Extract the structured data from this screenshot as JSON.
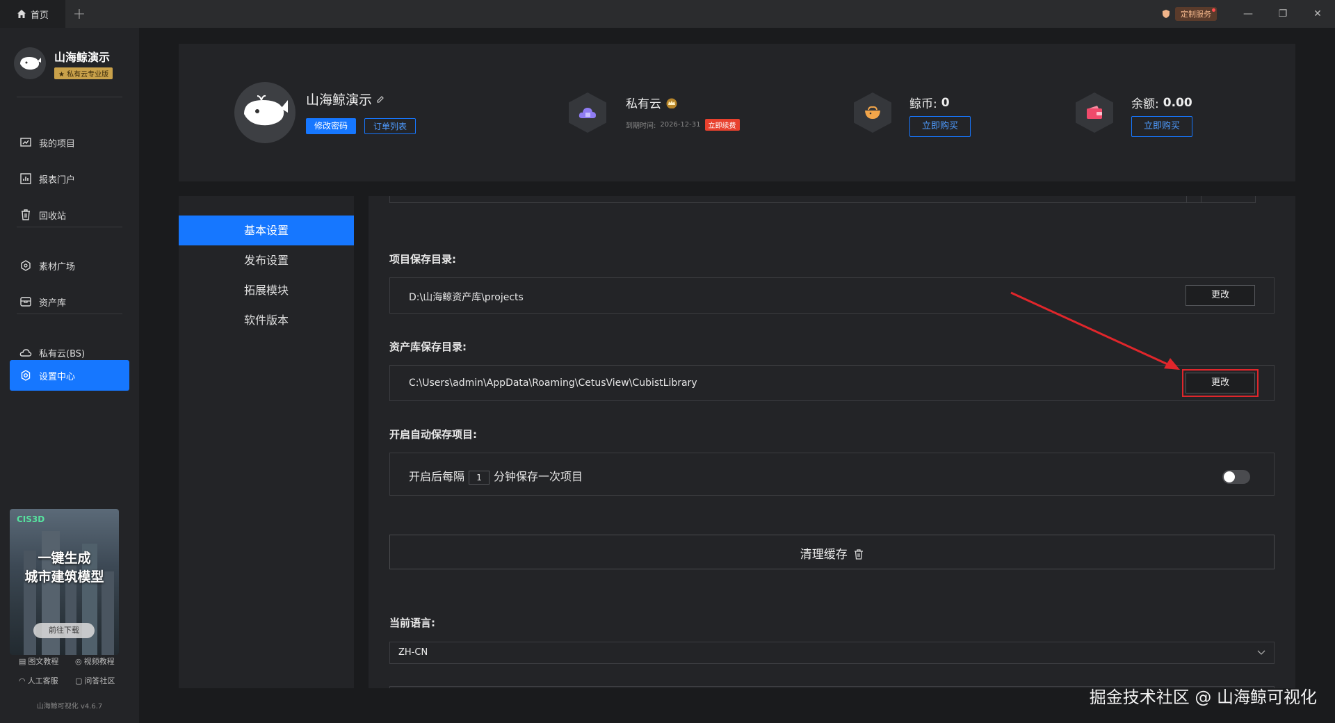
{
  "titlebar": {
    "home_tab": "首页",
    "add_tab": "+",
    "custom_service": "定制服务",
    "minimize": "—",
    "restore": "❐",
    "close": "✕"
  },
  "sidebar": {
    "brand_name": "山海鲸演示",
    "brand_badge": "★ 私有云专业版",
    "items": [
      {
        "label": "我的项目"
      },
      {
        "label": "报表门户"
      },
      {
        "label": "回收站"
      },
      {
        "label": "素材广场"
      },
      {
        "label": "资产库"
      },
      {
        "label": "私有云(BS)"
      },
      {
        "label": "设置中心"
      }
    ],
    "promo": {
      "logo": "CIS3D",
      "title_line1": "一键生成",
      "title_line2": "城市建筑模型",
      "button": "前往下载"
    },
    "help": {
      "doc_tutorial": "图文教程",
      "video_tutorial": "视频教程",
      "support": "人工客服",
      "community": "问答社区"
    },
    "version": "山海鲸可视化 v4.6.7"
  },
  "header": {
    "user_name": "山海鲸演示",
    "change_password": "修改密码",
    "order_list": "订单列表",
    "private_cloud": {
      "title": "私有云",
      "expire_label": "到期时间:",
      "expire_date": "2026-12-31",
      "renew": "立即续费"
    },
    "coins": {
      "label": "鲸币:",
      "value": "0",
      "buy": "立即购买"
    },
    "balance": {
      "label": "余额:",
      "value": "0.00",
      "buy": "立即购买"
    }
  },
  "settings_menu": {
    "items": [
      {
        "label": "基本设置"
      },
      {
        "label": "发布设置"
      },
      {
        "label": "拓展模块"
      },
      {
        "label": "软件版本"
      }
    ]
  },
  "settings": {
    "project_dir_label": "项目保存目录:",
    "project_dir_value": "D:\\山海鲸资产库\\projects",
    "asset_dir_label": "资产库保存目录:",
    "asset_dir_value": "C:\\Users\\admin\\AppData\\Roaming\\CetusView\\CubistLibrary",
    "change_label": "更改",
    "autosave_label": "开启自动保存项目:",
    "autosave_prefix": "开启后每隔",
    "autosave_interval": "1",
    "autosave_suffix": "分钟保存一次项目",
    "autosave_enabled": false,
    "clear_cache": "清理缓存",
    "language_label": "当前语言:",
    "language_value": "ZH-CN"
  },
  "watermark": "掘金技术社区 @ 山海鲸可视化",
  "colors": {
    "accent": "#1677ff",
    "highlight": "#e0262b",
    "renew": "#e8412e"
  }
}
